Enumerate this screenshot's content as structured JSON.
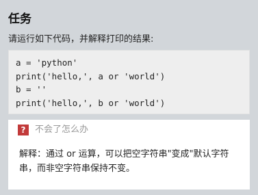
{
  "task": {
    "title": "任务",
    "prompt": "请运行如下代码，并解释打印的结果:"
  },
  "code": {
    "lines": [
      "a = 'python'",
      "print('hello,', a or 'world')",
      "b = ''",
      "print('hello,', b or 'world')"
    ]
  },
  "help": {
    "icon": "question-mark-icon",
    "icon_glyph": "?",
    "icon_color": "#c23a3a",
    "toggle_label": "不会了怎么办",
    "explanation": "解释：通过 or 运算，可以把空字符串\"变成\"默认字符串，而非空字符串保持不变。"
  }
}
